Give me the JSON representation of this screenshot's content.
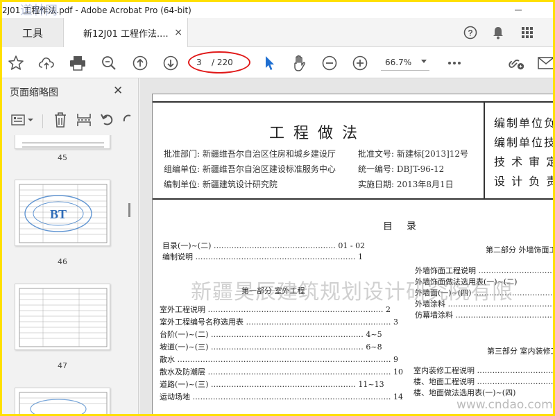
{
  "window": {
    "title": "2J01 工程作法.pdf - Adobe Acrobat Pro (64-bit)",
    "corner_watermark": "道林网"
  },
  "tabs": {
    "tools_label": "工具",
    "doc_label": "新12J01 工程作法....",
    "close_symbol": "×"
  },
  "toolbar": {
    "current_page": "3",
    "total_pages": "/ 220",
    "zoom": "66.7%"
  },
  "sidebar": {
    "title": "页面缩略图",
    "close_symbol": "✕",
    "thumbnails": [
      {
        "label": "45"
      },
      {
        "label": "46",
        "stamp": "BT"
      },
      {
        "label": "47"
      }
    ]
  },
  "document": {
    "header_title": "工程做法",
    "left_lines": [
      "批准部门: 新疆维吾尔自治区住房和城乡建设厅",
      "组编单位: 新疆维吾尔自治区建设标准服务中心",
      "编制单位: 新疆建筑设计研究院"
    ],
    "mid_lines": [
      "批准文号: 新建标[2013]12号",
      "统一编号: DBJT-96-12",
      "实施日期: 2013年8月1日"
    ],
    "right_lines": [
      "编制单位负",
      "编制单位技术",
      "技 术 审 定",
      "设 计 负 责"
    ],
    "toc_title": "目录",
    "toc_left_top": [
      "目录(一)~(二) ………………………………………… 01 - 02",
      "编制说明 ……………………………………………………… 1"
    ],
    "part1_head": "第一部分  室外工程",
    "toc_part1": [
      "室外工程说明 …………………………………………………………… 2",
      "室外工程编号名称选用表 ………………………………………………… 3",
      "台阶(一)~(二) …………………………………………………… 4~5",
      "坡道(一)~(三) …………………………………………………… 6~8",
      "散水 ………………………………………………………………………… 9",
      "散水及防潮层 ……………………………………………………………… 10",
      "道路(一)~(三) ………………………………………………… 11~13",
      "运动场地 …………………………………………………………………… 14"
    ],
    "part2_head": "第二部分  外墙饰面工",
    "toc_part2": [
      "外墙饰面工程说明 ……………………………………………",
      "外墙饰面做法选用表(一)~(二)",
      "外墙面(一)~(四) …………………………………………",
      "外墙涂料 …………………………………………………………",
      "仿幕墙涂料 ………………………………………………………"
    ],
    "part3_head": "第三部分  室内装修工",
    "toc_part3": [
      "室内装修工程说明 ………………………………………………",
      "楼、地面工程说明 ………………………………………………",
      "楼、地面做法选用表(一)~(四)"
    ],
    "watermark": "新疆昊辰建筑规划设计研究院有限",
    "site": "www.cndao.com"
  }
}
